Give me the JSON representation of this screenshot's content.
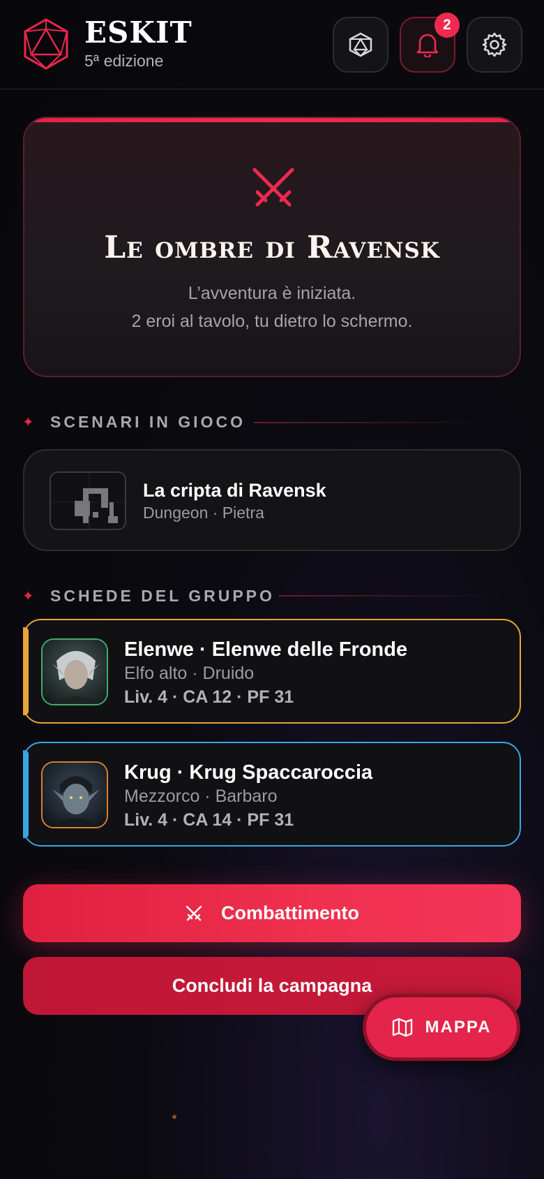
{
  "header": {
    "title": "ESKIT",
    "subtitle": "5ª edizione",
    "notifications_count": "2"
  },
  "hero": {
    "title": "Le ombre di Ravensk",
    "line1": "L’avventura è iniziata.",
    "line2": "2 eroi al tavolo, tu dietro lo schermo."
  },
  "scenarios": {
    "label": "SCENARI IN GIOCO",
    "items": [
      {
        "title": "La cripta di Ravensk",
        "subtitle": "Dungeon · Pietra"
      }
    ]
  },
  "party": {
    "label": "SCHEDE DEL GRUPPO",
    "members": [
      {
        "name": "Elenwe · Elenwe delle Fronde",
        "subtitle": "Elfo alto · Druido",
        "stats": "Liv. 4 · CA 12 · PF 31",
        "accent": "#e8a53a",
        "avatar_border": "#3fae6b"
      },
      {
        "name": "Krug · Krug Spaccaroccia",
        "subtitle": "Mezzorco · Barbaro",
        "stats": "Liv. 4 · CA 14 · PF 31",
        "accent": "#3aa6e3",
        "avatar_border": "#d9812e"
      }
    ]
  },
  "actions": {
    "combat_label": "Combattimento",
    "end_label": "Concludi la campagna",
    "map_label": "MAPPA"
  },
  "colors": {
    "accent": "#f0294f",
    "background": "#0b0a10"
  },
  "icons": {
    "logo": "d20-icon",
    "dice": "dice-icon",
    "notifications": "bell-icon",
    "settings": "gear-icon",
    "hero": "crossed-swords-icon",
    "map": "map-icon"
  }
}
